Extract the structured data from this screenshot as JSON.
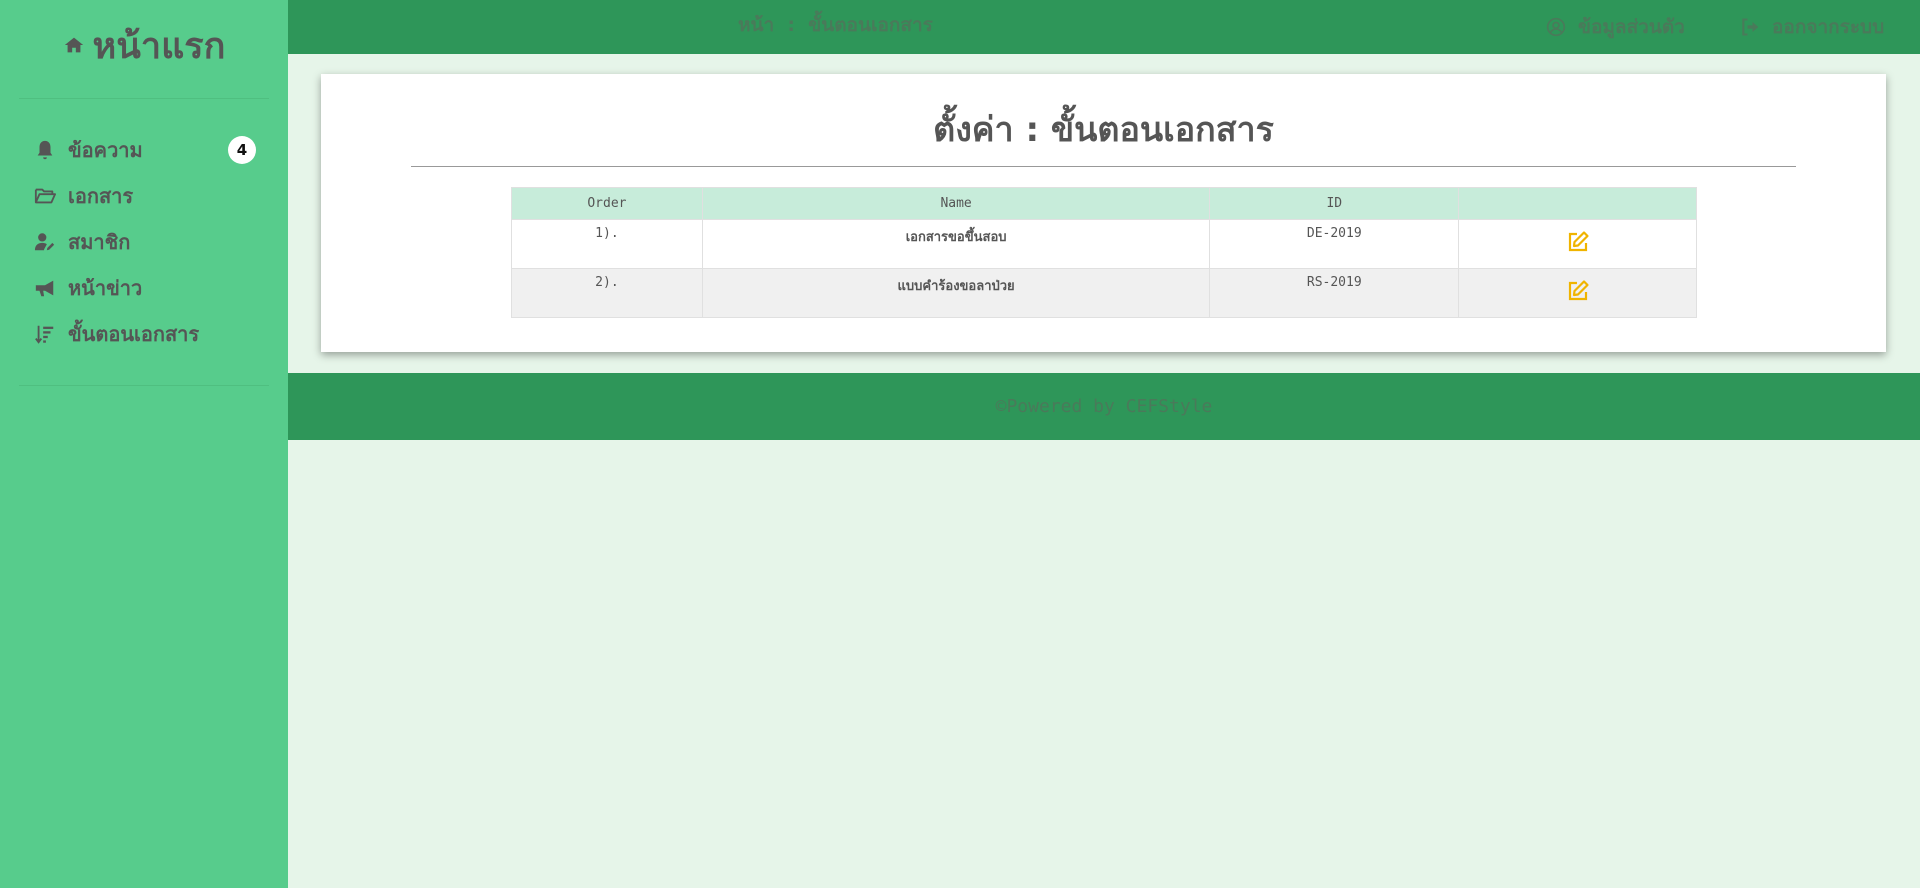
{
  "sidebar": {
    "brand": {
      "icon": "home-icon",
      "label": "หน้าแรก"
    },
    "items": [
      {
        "icon": "bell-icon",
        "label": "ข้อความ",
        "badge": "4"
      },
      {
        "icon": "folder-open-icon",
        "label": "เอกสาร"
      },
      {
        "icon": "user-edit-icon",
        "label": "สมาชิก"
      },
      {
        "icon": "bullhorn-icon",
        "label": "หน้าข่าว"
      },
      {
        "icon": "sort-amount-down-icon",
        "label": "ขั้นตอนเอกสาร"
      }
    ]
  },
  "topbar": {
    "breadcrumb": "หน้า  :  ขั้นตอนเอกสาร",
    "profile": {
      "icon": "user-circle-icon",
      "label": "ข้อมูลส่วนตัว"
    },
    "logout": {
      "icon": "sign-out-icon",
      "label": "ออกจากระบบ"
    }
  },
  "main": {
    "title": "ตั้งค่า : ขั้นตอนเอกสาร",
    "table": {
      "columns": [
        "Order",
        "Name",
        "ID",
        ""
      ],
      "rows": [
        {
          "order": "1).",
          "name": "เอกสารขอขึ้นสอบ",
          "id": "DE-2019",
          "action_icon": "edit-icon"
        },
        {
          "order": "2).",
          "name": "แบบคำร้องขอลาป่วย",
          "id": "RS-2019",
          "action_icon": "edit-icon"
        }
      ]
    }
  },
  "footer": {
    "text": "©Powered by CEFStyle"
  },
  "colors": {
    "sidebar": "#57cc8c",
    "topbar": "#2e9659",
    "background": "#e6f5e9",
    "table_header": "#c7ecda",
    "edit_icon": "#f0b400"
  }
}
